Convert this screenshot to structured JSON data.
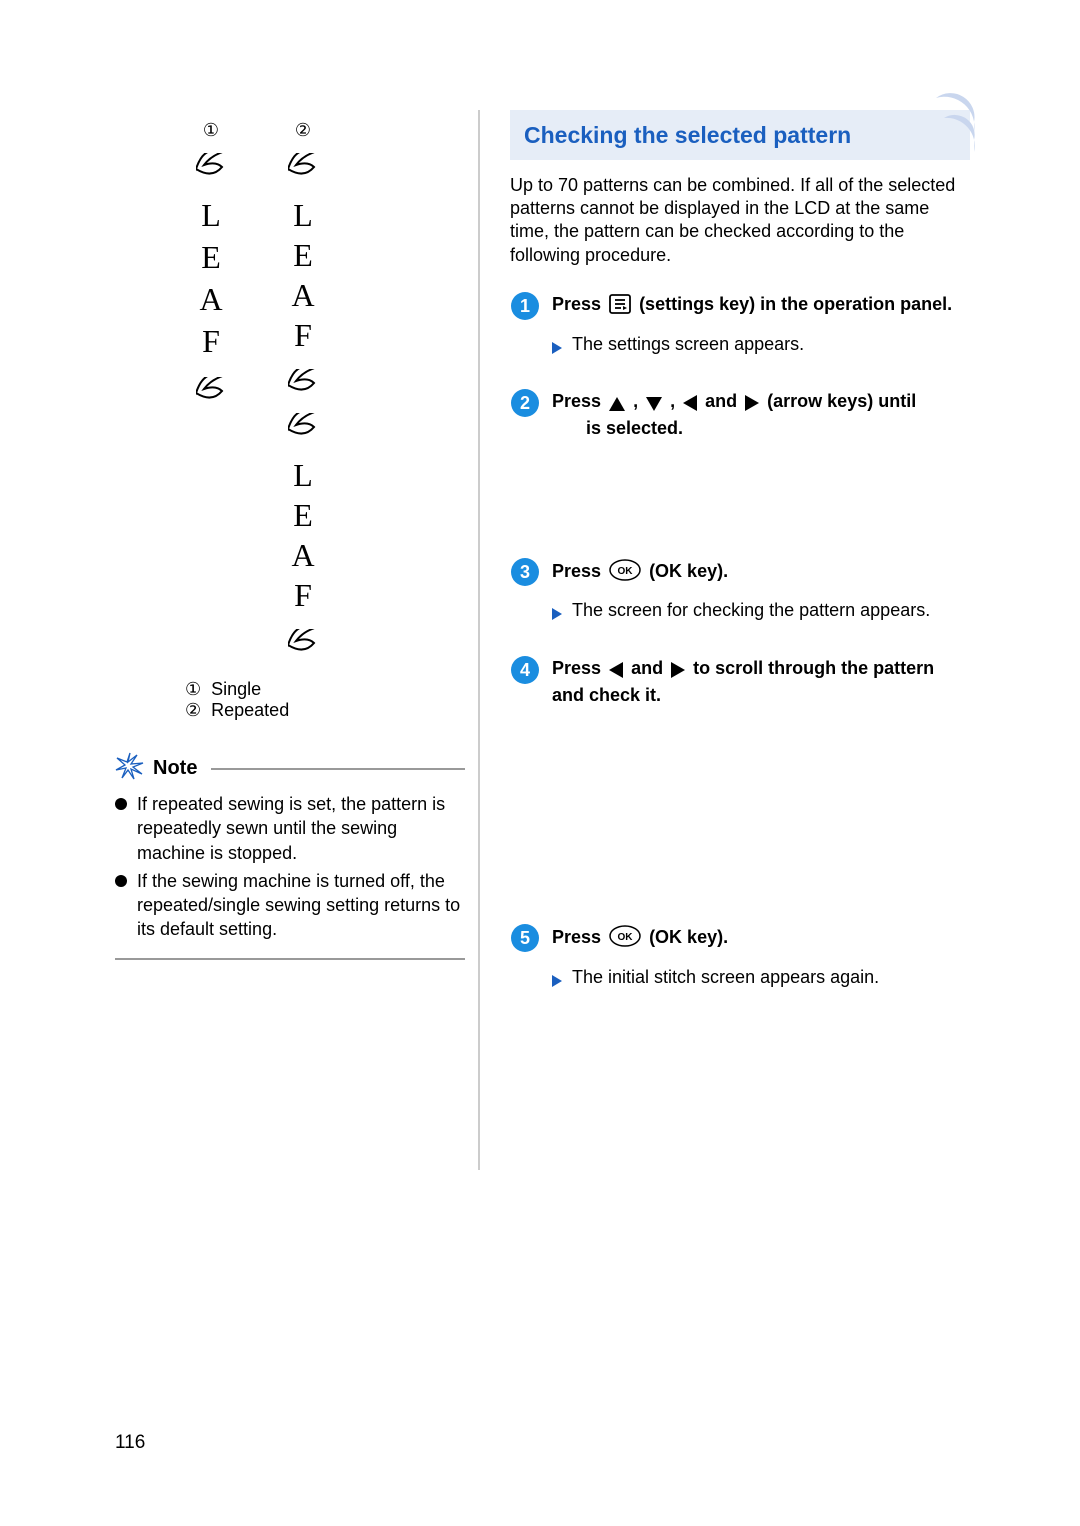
{
  "page_number": "116",
  "left": {
    "marker1": "①",
    "marker2": "②",
    "pattern_single_text": "LEAF",
    "pattern_repeated_text": "LEAF  LEAF",
    "legend1_num": "①",
    "legend1_text": "Single",
    "legend2_num": "②",
    "legend2_text": "Repeated",
    "note_label": "Note",
    "note_items": [
      "If repeated sewing is set, the pattern is repeatedly sewn until the sewing machine is stopped.",
      "If the sewing machine is turned off, the repeated/single sewing setting returns to its default setting."
    ]
  },
  "right": {
    "section_title": "Checking the selected pattern",
    "intro": "Up to 70 patterns can be combined. If all of the selected patterns cannot be displayed in the LCD at the same time, the pattern can be checked according to the following procedure.",
    "steps": [
      {
        "num": "1",
        "text_a": "Press ",
        "text_b": " (settings key) in the operation panel.",
        "sub": "The settings screen appears."
      },
      {
        "num": "2",
        "text_a": "Press ",
        "text_b": ", ",
        "text_c": ", ",
        "text_d": " and ",
        "text_e": " (arrow keys) until ",
        "text_f": " is selected."
      },
      {
        "num": "3",
        "text_a": "Press ",
        "text_b": " (OK key).",
        "sub": "The screen for checking the pattern appears."
      },
      {
        "num": "4",
        "text_a": "Press ",
        "text_b": " and ",
        "text_c": " to scroll through the pattern and check it."
      },
      {
        "num": "5",
        "text_a": "Press ",
        "text_b": " (OK key).",
        "sub": "The initial stitch screen appears again."
      }
    ]
  }
}
